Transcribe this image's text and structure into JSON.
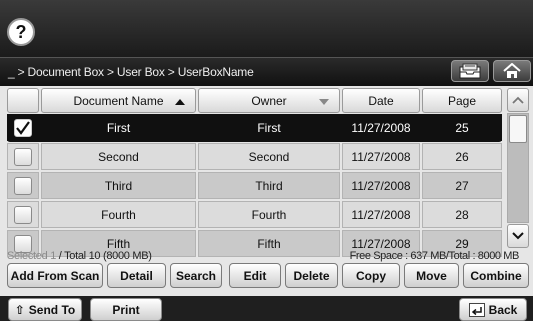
{
  "header": {
    "help_label": "?",
    "breadcrumb": "_ > Document Box > User Box > UserBoxName"
  },
  "table": {
    "columns": [
      "Document Name",
      "Owner",
      "Date",
      "Page"
    ],
    "rows": [
      {
        "name": "First",
        "owner": "First",
        "date": "11/27/2008",
        "page": "25",
        "selected": true
      },
      {
        "name": "Second",
        "owner": "Second",
        "date": "11/27/2008",
        "page": "26",
        "selected": false
      },
      {
        "name": "Third",
        "owner": "Third",
        "date": "11/27/2008",
        "page": "27",
        "selected": false
      },
      {
        "name": "Fourth",
        "owner": "Fourth",
        "date": "11/27/2008",
        "page": "28",
        "selected": false
      },
      {
        "name": "Fifth",
        "owner": "Fifth",
        "date": "11/27/2008",
        "page": "29",
        "selected": false
      }
    ]
  },
  "status": {
    "selected_label": "Selected",
    "selected_count": "1",
    "total": "/ Total 10 (8000 MB)",
    "free_space": "Free Space : 637 MB/Total : 8000 MB"
  },
  "actions": {
    "add_from_scan": "Add From Scan",
    "detail": "Detail",
    "search": "Search",
    "edit": "Edit",
    "delete": "Delete",
    "copy": "Copy",
    "move": "Move",
    "combine": "Combine"
  },
  "bottom": {
    "send_to": "Send To",
    "print": "Print",
    "back": "Back"
  },
  "colors": {
    "selected_row": "#101010",
    "row_even": "#dcdcdc",
    "row_odd": "#c9c9c9"
  }
}
